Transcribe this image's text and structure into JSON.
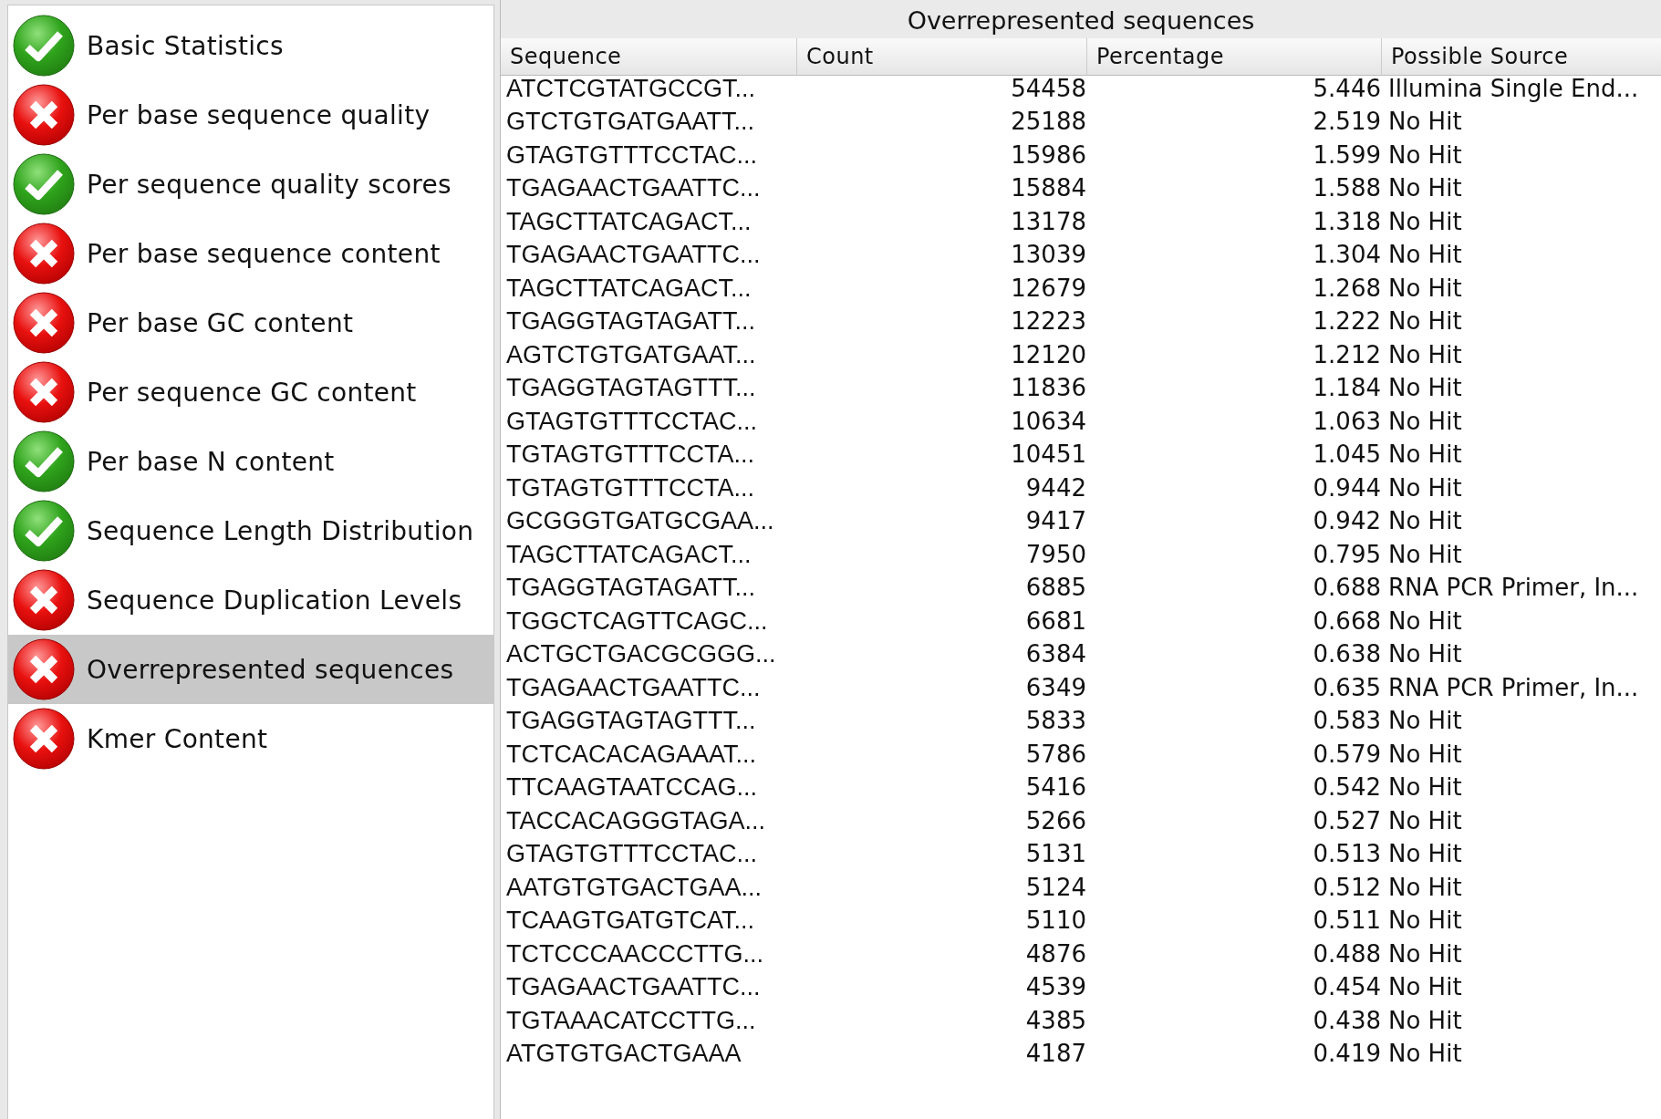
{
  "modules": [
    {
      "label": "Basic Statistics",
      "kind": "pass",
      "selected": false
    },
    {
      "label": "Per base sequence quality",
      "kind": "fail",
      "selected": false
    },
    {
      "label": "Per sequence quality scores",
      "kind": "pass",
      "selected": false
    },
    {
      "label": "Per base sequence content",
      "kind": "fail",
      "selected": false
    },
    {
      "label": "Per base GC content",
      "kind": "fail",
      "selected": false
    },
    {
      "label": "Per sequence GC content",
      "kind": "fail",
      "selected": false
    },
    {
      "label": "Per base N content",
      "kind": "pass",
      "selected": false
    },
    {
      "label": "Sequence Length Distribution",
      "kind": "pass",
      "selected": false
    },
    {
      "label": "Sequence Duplication Levels",
      "kind": "fail",
      "selected": false
    },
    {
      "label": "Overrepresented sequences",
      "kind": "fail",
      "selected": true
    },
    {
      "label": "Kmer Content",
      "kind": "fail",
      "selected": false
    }
  ],
  "table": {
    "title": "Overrepresented sequences",
    "columns": [
      "Sequence",
      "Count",
      "Percentage",
      "Possible Source"
    ],
    "rows": [
      [
        "ATCTCGTATGCCGT...",
        "54458",
        "5.446",
        "Illumina Single End..."
      ],
      [
        "GTCTGTGATGAATT...",
        "25188",
        "2.519",
        "No Hit"
      ],
      [
        "GTAGTGTTTCCTAC...",
        "15986",
        "1.599",
        "No Hit"
      ],
      [
        "TGAGAACTGAATTC...",
        "15884",
        "1.588",
        "No Hit"
      ],
      [
        "TAGCTTATCAGACT...",
        "13178",
        "1.318",
        "No Hit"
      ],
      [
        "TGAGAACTGAATTC...",
        "13039",
        "1.304",
        "No Hit"
      ],
      [
        "TAGCTTATCAGACT...",
        "12679",
        "1.268",
        "No Hit"
      ],
      [
        "TGAGGTAGTAGATT...",
        "12223",
        "1.222",
        "No Hit"
      ],
      [
        "AGTCTGTGATGAAT...",
        "12120",
        "1.212",
        "No Hit"
      ],
      [
        "TGAGGTAGTAGTTT...",
        "11836",
        "1.184",
        "No Hit"
      ],
      [
        "GTAGTGTTTCCTAC...",
        "10634",
        "1.063",
        "No Hit"
      ],
      [
        "TGTAGTGTTTCCTA...",
        "10451",
        "1.045",
        "No Hit"
      ],
      [
        "TGTAGTGTTTCCTA...",
        "9442",
        "0.944",
        "No Hit"
      ],
      [
        "GCGGGTGATGCGAA...",
        "9417",
        "0.942",
        "No Hit"
      ],
      [
        "TAGCTTATCAGACT...",
        "7950",
        "0.795",
        "No Hit"
      ],
      [
        "TGAGGTAGTAGATT...",
        "6885",
        "0.688",
        "RNA PCR Primer, In..."
      ],
      [
        "TGGCTCAGTTCAGC...",
        "6681",
        "0.668",
        "No Hit"
      ],
      [
        "ACTGCTGACGCGGG...",
        "6384",
        "0.638",
        "No Hit"
      ],
      [
        "TGAGAACTGAATTC...",
        "6349",
        "0.635",
        "RNA PCR Primer, In..."
      ],
      [
        "TGAGGTAGTAGTTT...",
        "5833",
        "0.583",
        "No Hit"
      ],
      [
        "TCTCACACAGAAAT...",
        "5786",
        "0.579",
        "No Hit"
      ],
      [
        "TTCAAGTAATCCAG...",
        "5416",
        "0.542",
        "No Hit"
      ],
      [
        "TACCACAGGGTAGA...",
        "5266",
        "0.527",
        "No Hit"
      ],
      [
        "GTAGTGTTTCCTAC...",
        "5131",
        "0.513",
        "No Hit"
      ],
      [
        "AATGTGTGACTGAA...",
        "5124",
        "0.512",
        "No Hit"
      ],
      [
        "TCAAGTGATGTCAT...",
        "5110",
        "0.511",
        "No Hit"
      ],
      [
        "TCTCCCAACCCTTG...",
        "4876",
        "0.488",
        "No Hit"
      ],
      [
        "TGAGAACTGAATTC...",
        "4539",
        "0.454",
        "No Hit"
      ],
      [
        "TGTAAACATCCTTG...",
        "4385",
        "0.438",
        "No Hit"
      ],
      [
        "ATGTGTGACTGAAA",
        "4187",
        "0.419",
        "No Hit"
      ]
    ]
  }
}
